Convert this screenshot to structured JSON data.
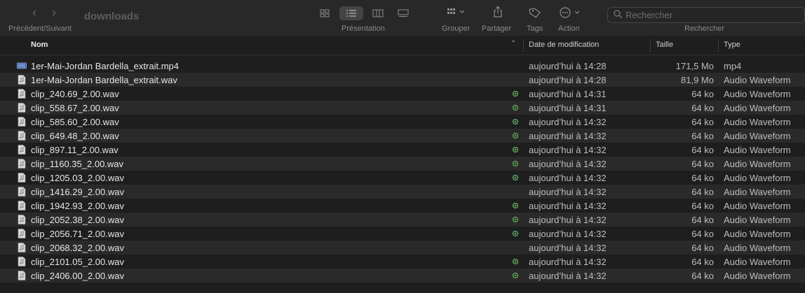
{
  "toolbar": {
    "nav_back_icon": "chevron-left-icon",
    "nav_forward_icon": "chevron-right-icon",
    "nav_caption": "Précédent/Suivant",
    "folder_title": "downloads",
    "view_caption": "Présentation",
    "group_caption": "Grouper",
    "share_caption": "Partager",
    "tags_caption": "Tags",
    "action_caption": "Action",
    "search_placeholder": "Rechercher",
    "search_caption": "Rechercher"
  },
  "columns": {
    "name": "Nom",
    "date": "Date de modification",
    "size": "Taille",
    "type": "Type"
  },
  "files": [
    {
      "name": "1er-Mai-Jordan Bardella_extrait.mp4",
      "date": "aujourd’hui à 14:28",
      "size": "171,5 Mo",
      "type": "mp4",
      "icon": "video-file-icon",
      "synced": false
    },
    {
      "name": "1er-Mai-Jordan Bardella_extrait.wav",
      "date": "aujourd’hui à 14:28",
      "size": "81,9 Mo",
      "type": "Audio Waveform",
      "icon": "audio-file-icon",
      "synced": false
    },
    {
      "name": "clip_240.69_2.00.wav",
      "date": "aujourd’hui à 14:31",
      "size": "64 ko",
      "type": "Audio Waveform",
      "icon": "audio-file-icon",
      "synced": true
    },
    {
      "name": "clip_558.67_2.00.wav",
      "date": "aujourd’hui à 14:31",
      "size": "64 ko",
      "type": "Audio Waveform",
      "icon": "audio-file-icon",
      "synced": true
    },
    {
      "name": "clip_585.60_2.00.wav",
      "date": "aujourd’hui à 14:32",
      "size": "64 ko",
      "type": "Audio Waveform",
      "icon": "audio-file-icon",
      "synced": true
    },
    {
      "name": "clip_649.48_2.00.wav",
      "date": "aujourd’hui à 14:32",
      "size": "64 ko",
      "type": "Audio Waveform",
      "icon": "audio-file-icon",
      "synced": true
    },
    {
      "name": "clip_897.11_2.00.wav",
      "date": "aujourd’hui à 14:32",
      "size": "64 ko",
      "type": "Audio Waveform",
      "icon": "audio-file-icon",
      "synced": true
    },
    {
      "name": "clip_1160.35_2.00.wav",
      "date": "aujourd’hui à 14:32",
      "size": "64 ko",
      "type": "Audio Waveform",
      "icon": "audio-file-icon",
      "synced": true
    },
    {
      "name": "clip_1205.03_2.00.wav",
      "date": "aujourd’hui à 14:32",
      "size": "64 ko",
      "type": "Audio Waveform",
      "icon": "audio-file-icon",
      "synced": true
    },
    {
      "name": "clip_1416.29_2.00.wav",
      "date": "aujourd’hui à 14:32",
      "size": "64 ko",
      "type": "Audio Waveform",
      "icon": "audio-file-icon",
      "synced": false
    },
    {
      "name": "clip_1942.93_2.00.wav",
      "date": "aujourd’hui à 14:32",
      "size": "64 ko",
      "type": "Audio Waveform",
      "icon": "audio-file-icon",
      "synced": true
    },
    {
      "name": "clip_2052.38_2.00.wav",
      "date": "aujourd’hui à 14:32",
      "size": "64 ko",
      "type": "Audio Waveform",
      "icon": "audio-file-icon",
      "synced": true
    },
    {
      "name": "clip_2056.71_2.00.wav",
      "date": "aujourd’hui à 14:32",
      "size": "64 ko",
      "type": "Audio Waveform",
      "icon": "audio-file-icon",
      "synced": true
    },
    {
      "name": "clip_2068.32_2.00.wav",
      "date": "aujourd’hui à 14:32",
      "size": "64 ko",
      "type": "Audio Waveform",
      "icon": "audio-file-icon",
      "synced": false
    },
    {
      "name": "clip_2101.05_2.00.wav",
      "date": "aujourd’hui à 14:32",
      "size": "64 ko",
      "type": "Audio Waveform",
      "icon": "audio-file-icon",
      "synced": true
    },
    {
      "name": "clip_2406.00_2.00.wav",
      "date": "aujourd’hui à 14:32",
      "size": "64 ko",
      "type": "Audio Waveform",
      "icon": "audio-file-icon",
      "synced": true
    }
  ],
  "colors": {
    "window_bg": "#1e1e1e",
    "toolbar_bg": "#282828",
    "alt_row": "#2a2a2a",
    "sync_green": "#66c46a"
  }
}
